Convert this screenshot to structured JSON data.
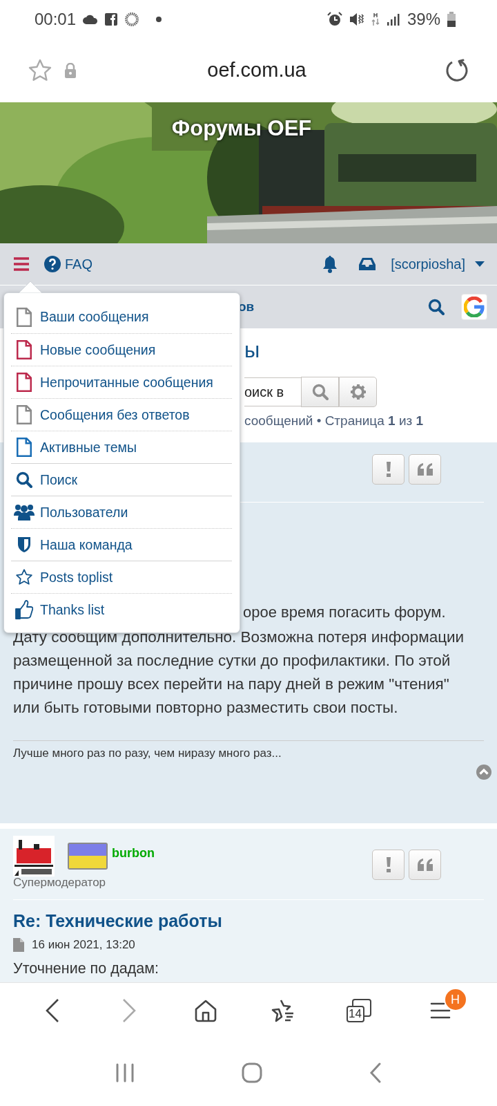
{
  "status_bar": {
    "time": "00:01",
    "network_type": "H",
    "battery": "39%"
  },
  "address_bar": {
    "url": "oef.com.ua"
  },
  "banner": {
    "title": "Форумы OEF"
  },
  "nav_bar": {
    "faq": "FAQ",
    "user": "[scorpiosha]",
    "breadcrumb_fragment": "ов"
  },
  "menu": {
    "groups": [
      [
        {
          "kind": "file",
          "label": "Ваши сообщения",
          "color": "#8a8a8a"
        },
        {
          "kind": "file",
          "label": "Новые сообщения",
          "color": "#bc2a4d"
        },
        {
          "kind": "file",
          "label": "Непрочитанные сообщения",
          "color": "#bc2a4d"
        },
        {
          "kind": "file",
          "label": "Сообщения без ответов",
          "color": "#8a8a8a"
        },
        {
          "kind": "file",
          "label": "Активные темы",
          "color": "#196db5"
        }
      ],
      [
        {
          "kind": "search",
          "label": "Поиск"
        }
      ],
      [
        {
          "kind": "users",
          "label": "Пользователи"
        },
        {
          "kind": "shield",
          "label": "Наша команда"
        }
      ],
      [
        {
          "kind": "star",
          "label": "Posts toplist"
        },
        {
          "kind": "thumbs-up",
          "label": "Thanks list"
        }
      ]
    ]
  },
  "topic": {
    "title_fragment": "ы",
    "search_placeholder": "оиск в",
    "pagination": "сообщений • Страница **1** из **1**"
  },
  "posts": [
    {
      "text_fragment": "орое время погасить форум.",
      "body": "Дату сообщим дополнительно. Возможна потеря информации размещенной за последние сутки до профилактики. По этой причине прошу всех перейти на пару дней в режим \"чтения\" или быть готовыми повторно разместить свои посты.",
      "signature": "Лучше много раз по разу, чем ниразу много раз..."
    },
    {
      "author": "burbon",
      "rank": "Супермодератор",
      "title": "Re: Технические работы",
      "date": "16 июн 2021, 13:20",
      "body_fragment": "Уточнение по дадам:"
    }
  ],
  "toolbar": [
    {
      "kind": "back",
      "disabled": false
    },
    {
      "kind": "forward",
      "disabled": true
    },
    {
      "kind": "home"
    },
    {
      "kind": "bookmarks"
    },
    {
      "kind": "tabs",
      "count": "14"
    },
    {
      "kind": "menu",
      "badge": "H"
    }
  ]
}
